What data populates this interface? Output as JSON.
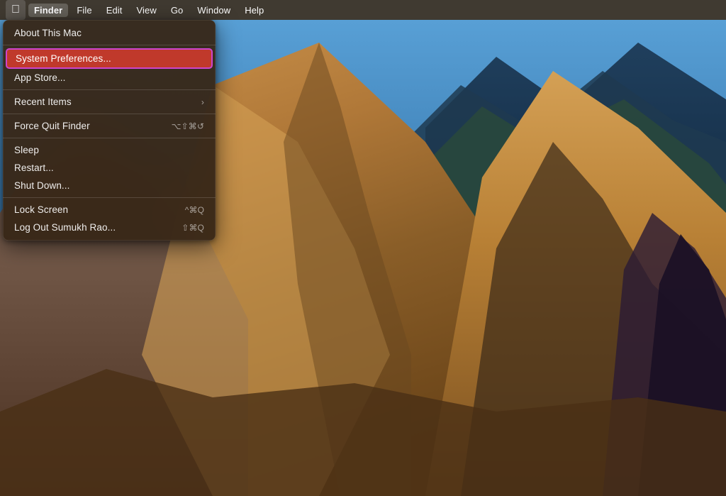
{
  "desktop": {
    "background_description": "macOS Big Sur mountain wallpaper"
  },
  "menubar": {
    "items": [
      {
        "id": "apple",
        "label": ""
      },
      {
        "id": "finder",
        "label": "Finder",
        "active": true
      },
      {
        "id": "file",
        "label": "File"
      },
      {
        "id": "edit",
        "label": "Edit"
      },
      {
        "id": "view",
        "label": "View"
      },
      {
        "id": "go",
        "label": "Go"
      },
      {
        "id": "window",
        "label": "Window"
      },
      {
        "id": "help",
        "label": "Help"
      }
    ]
  },
  "dropdown": {
    "items": [
      {
        "id": "about",
        "label": "About This Mac",
        "shortcut": "",
        "type": "item"
      },
      {
        "id": "sep1",
        "type": "separator"
      },
      {
        "id": "sysprefs",
        "label": "System Preferences...",
        "shortcut": "",
        "type": "item",
        "highlighted": true
      },
      {
        "id": "appstore",
        "label": "App Store...",
        "shortcut": "",
        "type": "item"
      },
      {
        "id": "sep2",
        "type": "separator"
      },
      {
        "id": "recent",
        "label": "Recent Items",
        "shortcut": "›",
        "type": "item",
        "hasChevron": true
      },
      {
        "id": "sep3",
        "type": "separator"
      },
      {
        "id": "forcequit",
        "label": "Force Quit Finder",
        "shortcut": "⌥⇧⌘↺",
        "type": "item"
      },
      {
        "id": "sep4",
        "type": "separator"
      },
      {
        "id": "sleep",
        "label": "Sleep",
        "shortcut": "",
        "type": "item"
      },
      {
        "id": "restart",
        "label": "Restart...",
        "shortcut": "",
        "type": "item"
      },
      {
        "id": "shutdown",
        "label": "Shut Down...",
        "shortcut": "",
        "type": "item"
      },
      {
        "id": "sep5",
        "type": "separator"
      },
      {
        "id": "lockscreen",
        "label": "Lock Screen",
        "shortcut": "^⌘Q",
        "type": "item"
      },
      {
        "id": "logout",
        "label": "Log Out Sumukh Rao...",
        "shortcut": "⇧⌘Q",
        "type": "item"
      }
    ]
  }
}
